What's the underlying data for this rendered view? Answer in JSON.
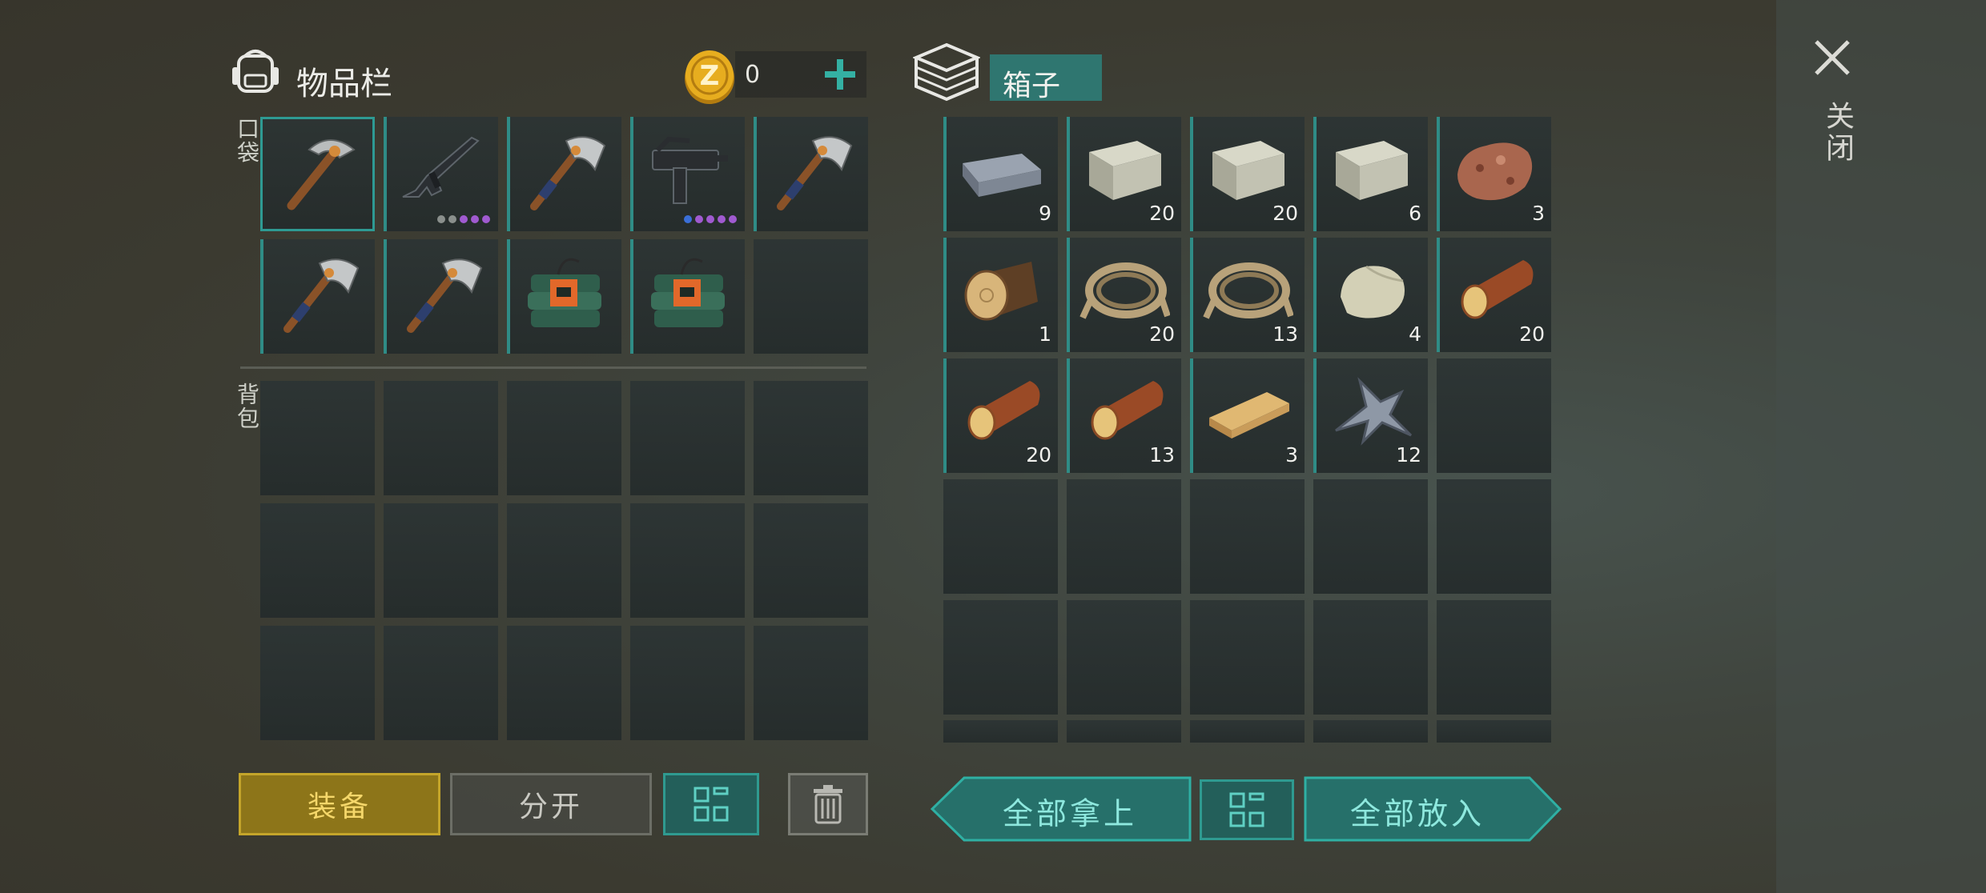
{
  "inventory": {
    "title": "物品栏",
    "coins": "0",
    "pocket_label": "口袋",
    "backpack_label": "背包"
  },
  "pocket_items": [
    {
      "icon": "pickaxe-icon",
      "selected": true,
      "count": ""
    },
    {
      "icon": "assault-rifle-icon",
      "count": "",
      "dots": [
        "#8a8f8c",
        "#8a8f8c",
        "#a05ad0",
        "#a05ad0",
        "#a05ad0"
      ]
    },
    {
      "icon": "hatchet-icon",
      "count": ""
    },
    {
      "icon": "uzi-icon",
      "count": "",
      "dots": [
        "#3a6fd8",
        "#a05ad0",
        "#a05ad0",
        "#a05ad0",
        "#a05ad0"
      ]
    },
    {
      "icon": "hatchet-icon",
      "count": ""
    },
    {
      "icon": "hatchet-icon",
      "count": ""
    },
    {
      "icon": "hatchet-icon",
      "count": ""
    },
    {
      "icon": "c4-explosive-icon",
      "count": ""
    },
    {
      "icon": "c4-explosive-icon",
      "count": ""
    },
    {
      "icon": "",
      "count": ""
    }
  ],
  "box": {
    "title": "箱子"
  },
  "box_items": [
    {
      "icon": "iron-ingot-icon",
      "count": "9"
    },
    {
      "icon": "stone-block-icon",
      "count": "20"
    },
    {
      "icon": "stone-block-icon",
      "count": "20"
    },
    {
      "icon": "stone-block-icon",
      "count": "6"
    },
    {
      "icon": "copper-ore-icon",
      "count": "3"
    },
    {
      "icon": "log-icon",
      "count": "1"
    },
    {
      "icon": "rope-icon",
      "count": "20"
    },
    {
      "icon": "rope-icon",
      "count": "13"
    },
    {
      "icon": "limestone-icon",
      "count": "4"
    },
    {
      "icon": "pine-log-icon",
      "count": "20"
    },
    {
      "icon": "pine-log-icon",
      "count": "20"
    },
    {
      "icon": "pine-log-icon",
      "count": "13"
    },
    {
      "icon": "plank-icon",
      "count": "3"
    },
    {
      "icon": "scrap-metal-icon",
      "count": "12"
    }
  ],
  "buttons": {
    "equip": "装备",
    "split": "分开",
    "take_all": "全部拿上",
    "put_all": "全部放入"
  },
  "close_label": "关闭",
  "colors": {
    "accent": "#2f8c86",
    "equip": "#a3891c",
    "coin": "#e0a91c"
  }
}
